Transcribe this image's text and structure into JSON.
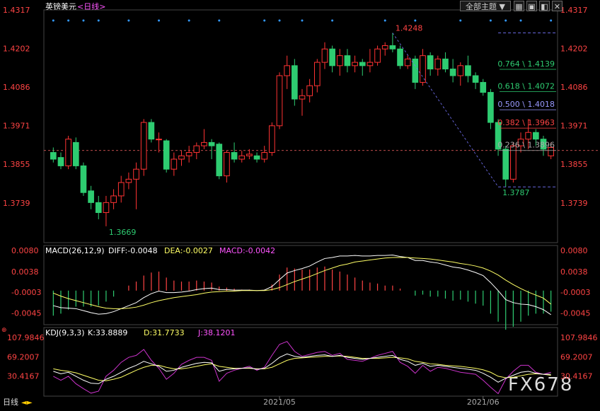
{
  "header": {
    "symbol": "英镑美元",
    "period": "<日线>",
    "theme_select": "全部主题",
    "theme_arrow": "▼"
  },
  "colors": {
    "up": "#ff3333",
    "down": "#2ecc71",
    "price_axis": "#ff4444",
    "macd_diff": "#ffffff",
    "macd_dea": "#ffff66",
    "macd_hist_pos": "#ff4444",
    "macd_hist_neg": "#2ecc71",
    "kdj_k": "#ffffff",
    "kdj_d": "#ffff66",
    "kdj_j": "#cc33cc",
    "fib_line": "#7777ff"
  },
  "chart_data": {
    "type": "candlestick",
    "instrument": "GBP/USD",
    "timeframe": "daily",
    "price_axis": {
      "ticks": [
        "1.4317",
        "1.4202",
        "1.4086",
        "1.3971",
        "1.3855",
        "1.3739"
      ],
      "range": [
        1.362,
        1.4317
      ]
    },
    "current_price": 1.3896,
    "annotations": {
      "high": "1.4248",
      "low_left": "1.3669",
      "low_right": "1.3787"
    },
    "fibonacci": [
      {
        "label": "0.764 \\ 1.4139",
        "value": 1.4139,
        "color": "#2ecc71"
      },
      {
        "label": "0.618 \\ 1.4072",
        "value": 1.4072,
        "color": "#2ecc71"
      },
      {
        "label": "0.500 \\ 1.4018",
        "value": 1.4018,
        "color": "#9999ff"
      },
      {
        "label": "0.382 \\ 1.3963",
        "value": 1.3963,
        "color": "#ff4444"
      },
      {
        "label": "0.236 \\ 1.3896",
        "value": 1.3896,
        "color": "#aaaaaa"
      }
    ],
    "fib_top": 1.4248,
    "fib_bottom": 1.3787,
    "x_labels": [
      "2021/05",
      "2021/06"
    ],
    "x_label_index": [
      30,
      57
    ],
    "candles": [
      [
        1.389,
        1.3905,
        1.386,
        1.387
      ],
      [
        1.3875,
        1.389,
        1.384,
        1.385
      ],
      [
        1.385,
        1.394,
        1.384,
        1.393
      ],
      [
        1.392,
        1.3935,
        1.384,
        1.385
      ],
      [
        1.385,
        1.386,
        1.376,
        1.377
      ],
      [
        1.3775,
        1.379,
        1.372,
        1.374
      ],
      [
        1.374,
        1.376,
        1.369,
        1.371
      ],
      [
        1.371,
        1.376,
        1.3669,
        1.374
      ],
      [
        1.374,
        1.378,
        1.372,
        1.376
      ],
      [
        1.376,
        1.382,
        1.374,
        1.38
      ],
      [
        1.38,
        1.383,
        1.378,
        1.381
      ],
      [
        1.381,
        1.386,
        1.372,
        1.384
      ],
      [
        1.384,
        1.399,
        1.382,
        1.398
      ],
      [
        1.398,
        1.399,
        1.392,
        1.393
      ],
      [
        1.393,
        1.395,
        1.389,
        1.393
      ],
      [
        1.3925,
        1.393,
        1.383,
        1.384
      ],
      [
        1.384,
        1.389,
        1.382,
        1.387
      ],
      [
        1.387,
        1.3895,
        1.385,
        1.388
      ],
      [
        1.388,
        1.391,
        1.386,
        1.389
      ],
      [
        1.389,
        1.392,
        1.387,
        1.391
      ],
      [
        1.391,
        1.396,
        1.39,
        1.392
      ],
      [
        1.392,
        1.393,
        1.387,
        1.391
      ],
      [
        1.3915,
        1.392,
        1.381,
        1.382
      ],
      [
        1.382,
        1.3895,
        1.38,
        1.389
      ],
      [
        1.389,
        1.392,
        1.386,
        1.387
      ],
      [
        1.387,
        1.3895,
        1.386,
        1.388
      ],
      [
        1.388,
        1.39,
        1.387,
        1.3885
      ],
      [
        1.388,
        1.389,
        1.386,
        1.387
      ],
      [
        1.387,
        1.391,
        1.386,
        1.389
      ],
      [
        1.389,
        1.398,
        1.388,
        1.397
      ],
      [
        1.397,
        1.413,
        1.396,
        1.412
      ],
      [
        1.412,
        1.418,
        1.408,
        1.415
      ],
      [
        1.415,
        1.417,
        1.403,
        1.405
      ],
      [
        1.405,
        1.408,
        1.4,
        1.406
      ],
      [
        1.406,
        1.411,
        1.404,
        1.409
      ],
      [
        1.409,
        1.417,
        1.407,
        1.416
      ],
      [
        1.416,
        1.422,
        1.414,
        1.42
      ],
      [
        1.42,
        1.421,
        1.413,
        1.415
      ],
      [
        1.415,
        1.42,
        1.412,
        1.418
      ],
      [
        1.418,
        1.42,
        1.413,
        1.415
      ],
      [
        1.415,
        1.418,
        1.413,
        1.416
      ],
      [
        1.416,
        1.417,
        1.412,
        1.415
      ],
      [
        1.415,
        1.42,
        1.413,
        1.416
      ],
      [
        1.416,
        1.421,
        1.415,
        1.42
      ],
      [
        1.42,
        1.422,
        1.418,
        1.421
      ],
      [
        1.421,
        1.4248,
        1.419,
        1.42
      ],
      [
        1.42,
        1.421,
        1.414,
        1.415
      ],
      [
        1.415,
        1.418,
        1.414,
        1.417
      ],
      [
        1.417,
        1.418,
        1.408,
        1.41
      ],
      [
        1.41,
        1.42,
        1.409,
        1.418
      ],
      [
        1.418,
        1.419,
        1.412,
        1.414
      ],
      [
        1.414,
        1.418,
        1.412,
        1.417
      ],
      [
        1.417,
        1.419,
        1.413,
        1.414
      ],
      [
        1.414,
        1.417,
        1.41,
        1.412
      ],
      [
        1.412,
        1.416,
        1.409,
        1.415
      ],
      [
        1.415,
        1.418,
        1.41,
        1.412
      ],
      [
        1.412,
        1.413,
        1.408,
        1.41
      ],
      [
        1.41,
        1.411,
        1.406,
        1.407
      ],
      [
        1.407,
        1.408,
        1.396,
        1.398
      ],
      [
        1.398,
        1.399,
        1.388,
        1.39
      ],
      [
        1.39,
        1.391,
        1.3787,
        1.381
      ],
      [
        1.381,
        1.392,
        1.38,
        1.391
      ],
      [
        1.391,
        1.395,
        1.389,
        1.393
      ],
      [
        1.393,
        1.399,
        1.39,
        1.395
      ],
      [
        1.395,
        1.396,
        1.391,
        1.393
      ],
      [
        1.393,
        1.394,
        1.388,
        1.39
      ],
      [
        1.388,
        1.392,
        1.387,
        1.3905
      ]
    ],
    "macd": {
      "label": "MACD(26,12,9)",
      "diff": -0.0048,
      "dea": -0.0027,
      "macd": -0.0042,
      "axis_ticks": [
        "0.0080",
        "0.0038",
        "-0.0003",
        "-0.0045"
      ],
      "range": [
        -0.0068,
        0.009
      ],
      "diff_series": [
        -0.003,
        -0.0034,
        -0.0035,
        -0.0036,
        -0.004,
        -0.0044,
        -0.0047,
        -0.0046,
        -0.0042,
        -0.0036,
        -0.003,
        -0.0024,
        -0.0014,
        -0.0006,
        -0.0001,
        -0.0004,
        -0.0004,
        -0.0003,
        -0.0001,
        0.0002,
        0.0004,
        0.0005,
        0.0002,
        0.0002,
        0.0001,
        0.0001,
        0.0001,
        0.0,
        0.0001,
        0.0008,
        0.0022,
        0.0035,
        0.004,
        0.0044,
        0.0049,
        0.0057,
        0.0064,
        0.0066,
        0.0069,
        0.0069,
        0.007,
        0.0069,
        0.0069,
        0.007,
        0.007,
        0.0071,
        0.0068,
        0.0066,
        0.006,
        0.006,
        0.0057,
        0.0055,
        0.0051,
        0.0047,
        0.0045,
        0.0041,
        0.0036,
        0.003,
        0.0016,
        0.0,
        -0.0018,
        -0.0024,
        -0.0027,
        -0.0028,
        -0.0032,
        -0.0038,
        -0.0048
      ],
      "dea_series": [
        -0.0005,
        -0.0011,
        -0.0016,
        -0.002,
        -0.0024,
        -0.0028,
        -0.0032,
        -0.0035,
        -0.0036,
        -0.0036,
        -0.0035,
        -0.0033,
        -0.0029,
        -0.0024,
        -0.002,
        -0.0017,
        -0.0014,
        -0.0012,
        -0.001,
        -0.0008,
        -0.0005,
        -0.0003,
        -0.0002,
        -0.0001,
        -0.0001,
        0.0,
        0.0,
        0.0,
        0.0,
        0.0002,
        0.0006,
        0.0012,
        0.0018,
        0.0023,
        0.0028,
        0.0034,
        0.004,
        0.0045,
        0.005,
        0.0053,
        0.0057,
        0.0059,
        0.0061,
        0.0063,
        0.0065,
        0.0066,
        0.0066,
        0.0066,
        0.0065,
        0.0064,
        0.0063,
        0.0061,
        0.0059,
        0.0057,
        0.0054,
        0.0052,
        0.0049,
        0.0045,
        0.0039,
        0.0031,
        0.0021,
        0.0012,
        0.0004,
        -0.0003,
        -0.0009,
        -0.0015,
        -0.0027
      ]
    },
    "kdj": {
      "label": "KDJ(9,3,3)",
      "k": 33.8889,
      "d": 31.7733,
      "j": 38.1201,
      "axis_ticks": [
        "107.9846",
        "69.2007",
        "30.4167"
      ],
      "range": [
        -10,
        128
      ],
      "k_series": [
        40,
        35,
        38,
        30,
        22,
        16,
        15,
        24,
        30,
        38,
        46,
        52,
        60,
        55,
        50,
        40,
        42,
        48,
        52,
        56,
        58,
        57,
        40,
        44,
        45,
        46,
        47,
        44,
        46,
        56,
        68,
        75,
        70,
        68,
        70,
        72,
        73,
        70,
        72,
        68,
        66,
        64,
        66,
        68,
        70,
        72,
        64,
        60,
        52,
        56,
        50,
        52,
        50,
        48,
        46,
        44,
        42,
        36,
        28,
        18,
        26,
        32,
        38,
        40,
        36,
        34,
        34
      ],
      "d_series": [
        45,
        42,
        40,
        37,
        32,
        27,
        22,
        21,
        24,
        28,
        35,
        42,
        48,
        52,
        52,
        48,
        45,
        45,
        47,
        50,
        53,
        55,
        50,
        48,
        46,
        46,
        46,
        45,
        45,
        48,
        55,
        62,
        66,
        67,
        68,
        69,
        70,
        70,
        71,
        70,
        68,
        66,
        66,
        66,
        67,
        68,
        67,
        65,
        60,
        58,
        55,
        54,
        52,
        51,
        50,
        48,
        46,
        43,
        38,
        30,
        27,
        28,
        31,
        34,
        35,
        34,
        32
      ],
      "j_series": [
        30,
        22,
        30,
        15,
        5,
        -4,
        0,
        30,
        42,
        58,
        68,
        72,
        84,
        62,
        46,
        24,
        36,
        54,
        62,
        68,
        68,
        62,
        20,
        36,
        42,
        46,
        50,
        42,
        48,
        72,
        94,
        100,
        80,
        70,
        74,
        78,
        80,
        72,
        76,
        64,
        62,
        60,
        66,
        72,
        76,
        80,
        58,
        50,
        36,
        52,
        40,
        48,
        46,
        42,
        38,
        36,
        34,
        22,
        8,
        -5,
        24,
        40,
        52,
        52,
        38,
        34,
        38
      ]
    }
  },
  "watermark": "FX678"
}
